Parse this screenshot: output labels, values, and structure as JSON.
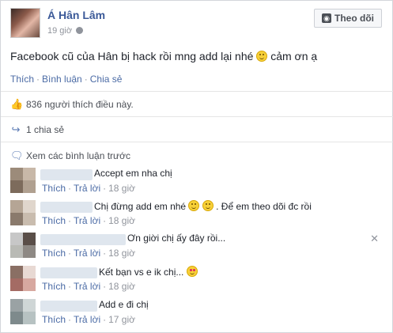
{
  "post": {
    "author": "Á Hân Lâm",
    "time": "19 giờ",
    "follow_label": "Theo dõi",
    "text": "Facebook cũ của Hân bị hack rồi mng add lại nhé",
    "text_tail": "cảm ơn ạ",
    "actions": [
      "Thích",
      "Bình luận",
      "Chia sẻ"
    ]
  },
  "likes": {
    "text": "836 người thích điều này."
  },
  "shares": {
    "text": "1 chia sẻ"
  },
  "view_previous": "Xem các bình luận trước",
  "comment_actions": {
    "like": "Thích",
    "reply": "Trả lời"
  },
  "comments": [
    {
      "text": "Accept em nha chị",
      "time": "18 giờ"
    },
    {
      "text": "Chị đừng add em nhé",
      "text_tail": ". Để em theo dõi đc rồi",
      "time": "18 giờ"
    },
    {
      "text": "Ơn giời chị ấy đây rồi...",
      "time": "18 giờ"
    },
    {
      "text": "Kết bạn vs e ik chị...",
      "time": "18 giờ"
    },
    {
      "text": "Add e đi chị",
      "time": "17 giờ"
    }
  ],
  "icons": {
    "rss": "rss-icon",
    "like": "thumbs-up-icon",
    "share": "share-arrow-icon",
    "comment": "comment-bubble-icon",
    "close": "close-icon"
  },
  "colors": {
    "link": "#3b5998",
    "action_link": "#4b6ba5",
    "muted": "#90949c"
  }
}
